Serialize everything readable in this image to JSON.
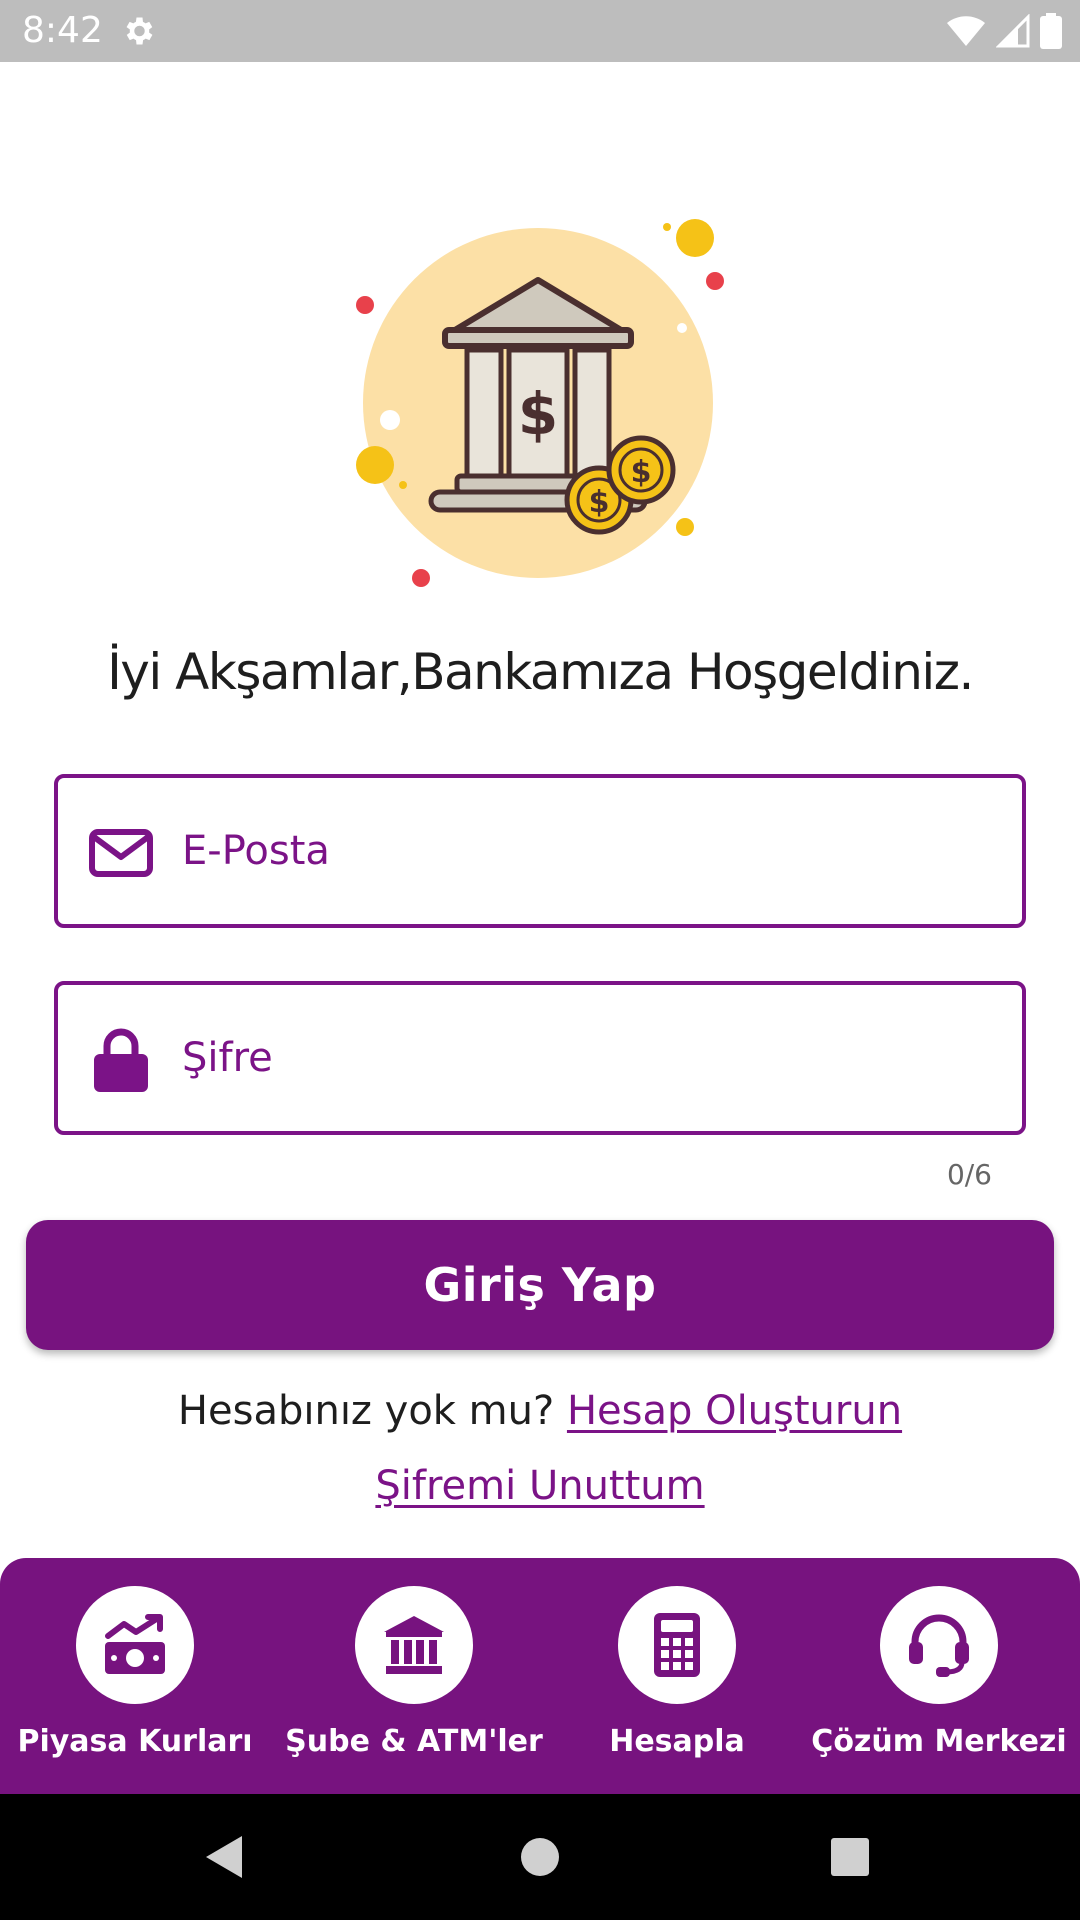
{
  "status_bar": {
    "time": "8:42",
    "icons": [
      "gear-icon",
      "wifi-icon",
      "signal-icon",
      "battery-icon"
    ]
  },
  "illustration": {
    "icon": "bank-dollar-illustration"
  },
  "welcome_text": "İyi Akşamlar,Bankamıza Hoşgeldiniz.",
  "email": {
    "placeholder": "E-Posta",
    "value": "",
    "icon": "envelope-icon"
  },
  "password": {
    "placeholder": "Şifre",
    "value": "",
    "icon": "lock-icon",
    "counter": "0/6"
  },
  "login_button": "Giriş Yap",
  "signup": {
    "prompt": "Hesabınız yok mu?",
    "link": "Hesap Oluşturun"
  },
  "forgot_password": "Şifremi Unuttum",
  "bottom_nav": [
    {
      "label": "Piyasa Kurları",
      "icon": "currency-rates-icon"
    },
    {
      "label": "Şube & ATM'ler",
      "icon": "bank-branch-icon"
    },
    {
      "label": "Hesapla",
      "icon": "calculator-icon"
    },
    {
      "label": "Çözüm Merkezi",
      "icon": "headset-support-icon"
    }
  ],
  "system_nav": [
    "back-icon",
    "home-icon",
    "recents-icon"
  ],
  "colors": {
    "brand": "#77137f",
    "status_bar": "#bdbdbd",
    "text": "#1e1e1e"
  }
}
